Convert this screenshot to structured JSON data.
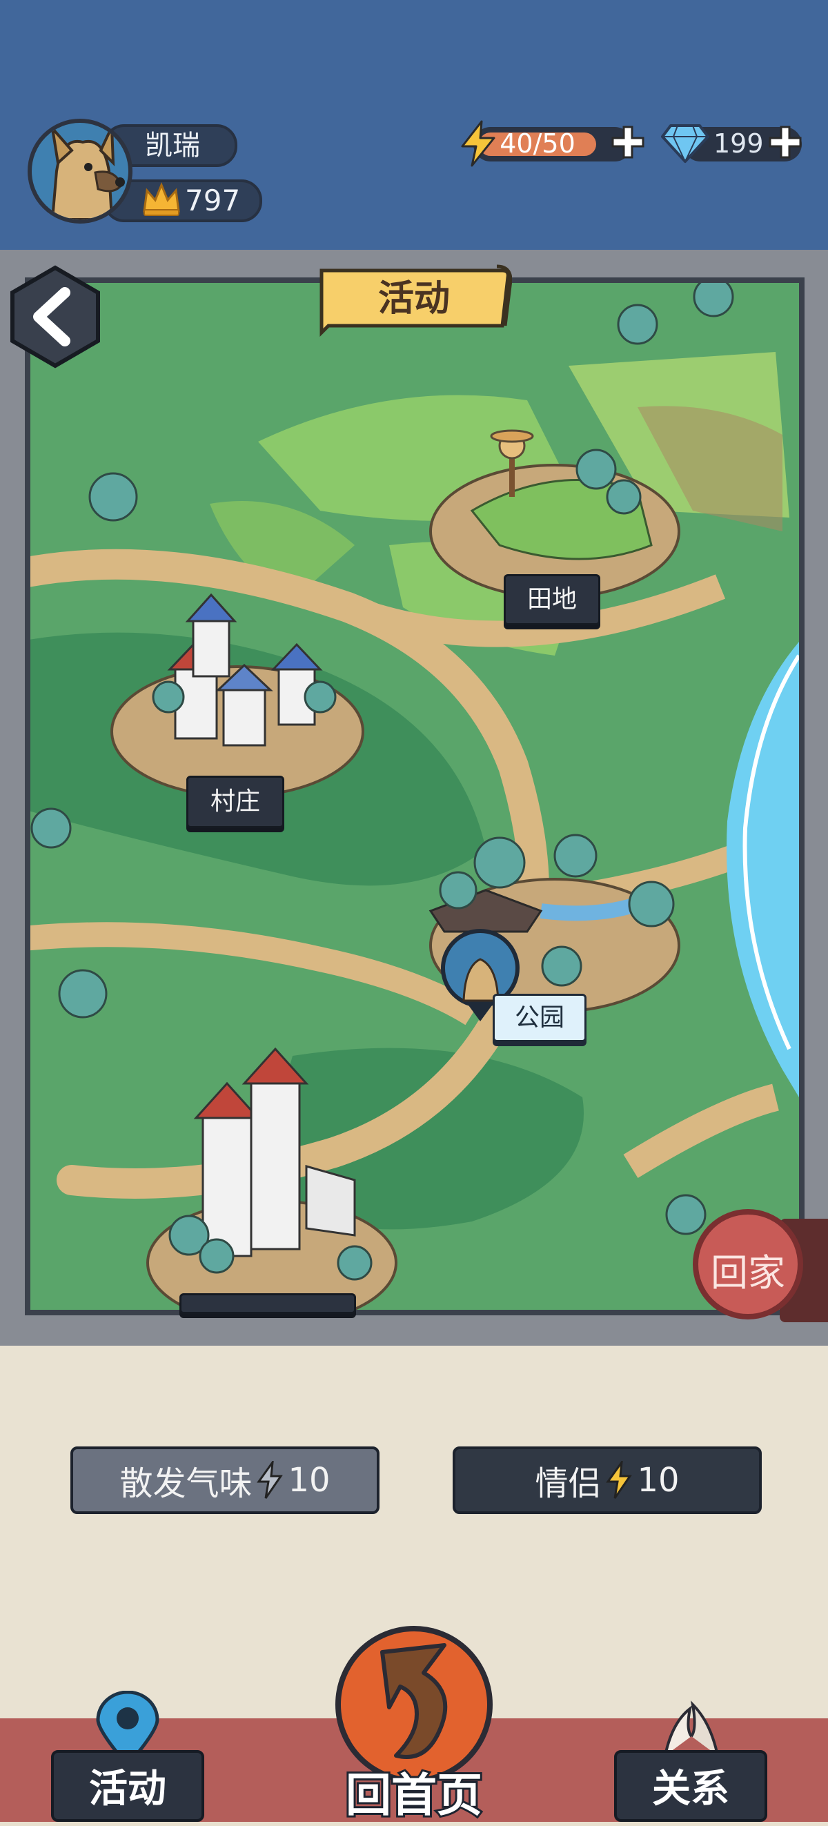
{
  "player": {
    "name": "凯瑞",
    "score": "797"
  },
  "resources": {
    "energy": "40/50",
    "gems": "199"
  },
  "map": {
    "banner": "活动",
    "locations": {
      "field": "田地",
      "village": "村庄",
      "park": "公园"
    },
    "home_button": "回家"
  },
  "actions": [
    {
      "label": "散发气味",
      "cost": "10"
    },
    {
      "label": "情侣",
      "cost": "10"
    }
  ],
  "nav": {
    "activity": "活动",
    "home": "回首页",
    "relation": "关系"
  }
}
